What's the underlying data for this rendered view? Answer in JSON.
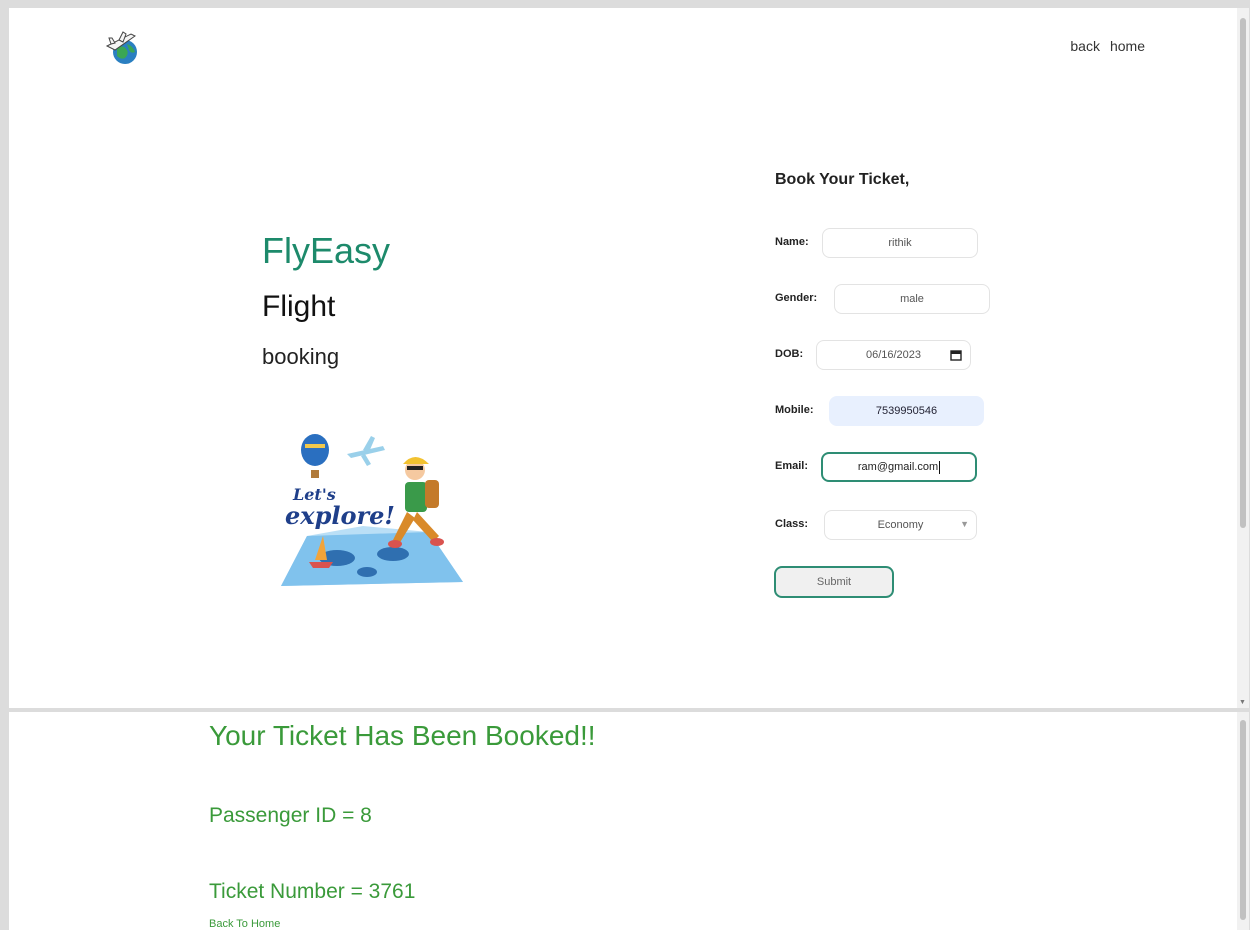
{
  "header": {
    "logo_icon": "globe-airplane-logo-icon",
    "nav": [
      {
        "label": "back"
      },
      {
        "label": "home"
      }
    ]
  },
  "brand": {
    "title": "FlyEasy",
    "subtitle": "Flight",
    "tagline": "booking",
    "illustration_text_1": "Let's",
    "illustration_text_2": "explore!"
  },
  "form": {
    "heading": "Book Your Ticket,",
    "name": {
      "label": "Name:",
      "value": "rithik"
    },
    "gender": {
      "label": "Gender:",
      "value": "male"
    },
    "dob": {
      "label": "DOB:",
      "value": "06/16/2023"
    },
    "mobile": {
      "label": "Mobile:",
      "value": "7539950546"
    },
    "email": {
      "label": "Email:",
      "value": "ram@gmail.com"
    },
    "class": {
      "label": "Class:",
      "value": "Economy"
    },
    "submit_label": "Submit"
  },
  "confirmation": {
    "title": "Your Ticket Has Been Booked!!",
    "passenger_line": "Passenger ID = 8",
    "ticket_line": "Ticket Number = 3761",
    "back_link": "Back To Home"
  },
  "colors": {
    "brand_green": "#1d8a6b",
    "focus_border": "#2e8d74",
    "confirm_green": "#3a9a3a",
    "autofill_bg": "#e8f0fe"
  }
}
